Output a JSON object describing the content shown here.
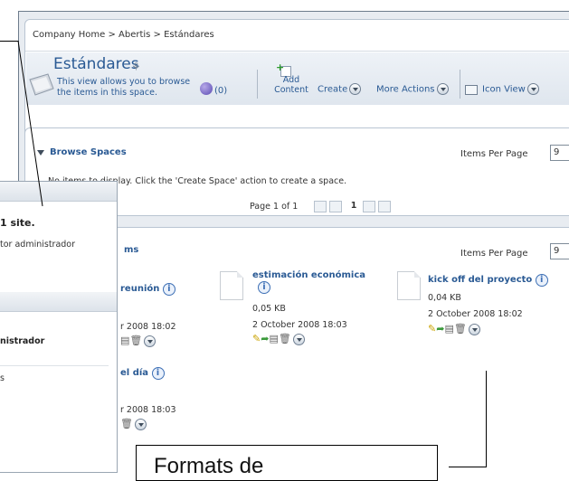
{
  "breadcrumb": "Company Home > Abertis > Estándares",
  "space": {
    "title": "Estándares",
    "description": "This view allows you to browse the items in this space.",
    "users_count": "(0)"
  },
  "toolbar": {
    "add_content": "Add Content",
    "create": "Create",
    "more_actions": "More Actions",
    "icon_view": "Icon View"
  },
  "browse_spaces": {
    "title": "Browse Spaces",
    "items_per_page_label": "Items Per Page",
    "items_per_page_value": "9",
    "empty_message": "No items to display. Click the 'Create Space' action to create a space.",
    "pager_text": "Page 1 of 1",
    "current_page": "1"
  },
  "content_items": {
    "title_fragment": "ms",
    "items_per_page_label": "Items Per Page",
    "items_per_page_value": "9",
    "items": [
      {
        "name": "reunión",
        "size": "",
        "date": "r 2008 18:02"
      },
      {
        "name": "estimación económica",
        "size": "0,05 KB",
        "date": "2 October 2008 18:03"
      },
      {
        "name": "kick off del proyecto",
        "size": "0,04 KB",
        "date": "2 October 2008 18:02"
      },
      {
        "name": "el día",
        "size": "",
        "date": "r 2008 18:03"
      }
    ]
  },
  "left_overlay": {
    "site_text": "1 site.",
    "admin_line": "tor administrador",
    "admin_bold": "nistrador",
    "s_text": "s"
  },
  "callout": {
    "text": "Formats de"
  },
  "colors": {
    "accent": "#2a5a94",
    "panel_bg": "#e8ecf1",
    "border": "#b9c5d2"
  }
}
